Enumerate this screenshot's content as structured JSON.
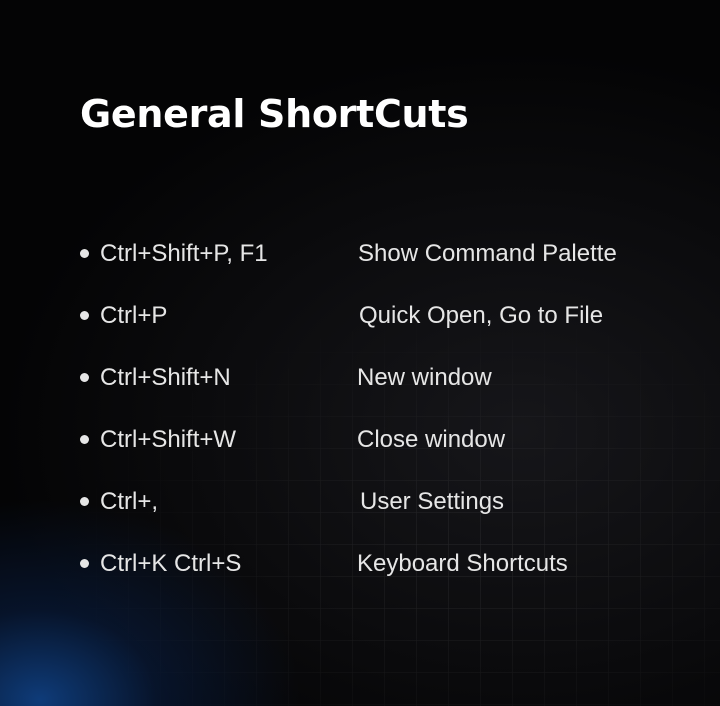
{
  "title": "General ShortCuts",
  "shortcuts": [
    {
      "keys": "Ctrl+Shift+P, F1",
      "action": "Show Command Palette"
    },
    {
      "keys": "Ctrl+P",
      "action": "Quick Open, Go to File"
    },
    {
      "keys": "Ctrl+Shift+N",
      "action": "New window"
    },
    {
      "keys": "Ctrl+Shift+W",
      "action": "Close window"
    },
    {
      "keys": "Ctrl+,",
      "action": "User Settings"
    },
    {
      "keys": "Ctrl+K Ctrl+S",
      "action": "Keyboard Shortcuts"
    }
  ],
  "colors": {
    "background": "#000000",
    "title": "#ffffff",
    "text": "#e6e6e6",
    "glow": "#124ea0"
  }
}
